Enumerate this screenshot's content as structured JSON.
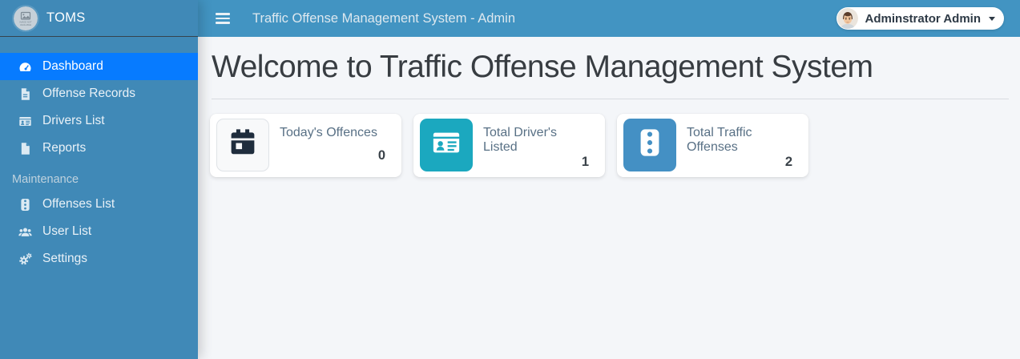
{
  "brand": {
    "name": "TOMS",
    "logo_placeholder_line1": "IMAGE NOT",
    "logo_placeholder_line2": "AVAILABLE"
  },
  "topbar": {
    "title": "Traffic Offense Management System - Admin",
    "user_name": "Adminstrator Admin"
  },
  "sidebar": {
    "nav_items": [
      {
        "label": "Dashboard",
        "icon": "tachometer-icon",
        "active": true
      },
      {
        "label": "Offense Records",
        "icon": "file-lines-icon",
        "active": false
      },
      {
        "label": "Drivers List",
        "icon": "id-card-icon",
        "active": false
      },
      {
        "label": "Reports",
        "icon": "file-icon",
        "active": false
      }
    ],
    "section_label": "Maintenance",
    "section_items": [
      {
        "label": "Offenses List",
        "icon": "traffic-light-icon",
        "active": false
      },
      {
        "label": "User List",
        "icon": "users-icon",
        "active": false
      },
      {
        "label": "Settings",
        "icon": "cogs-icon",
        "active": false
      }
    ]
  },
  "content": {
    "heading": "Welcome to Traffic Offense Management System",
    "stat_cards": [
      {
        "label": "Today's Offences",
        "value": "0",
        "icon": "calendar-icon",
        "icon_bg": "#f8f9fa",
        "icon_color": "#1f2d3d",
        "icon_border": "#dfe3e7"
      },
      {
        "label": "Total Driver's Listed",
        "value": "1",
        "icon": "id-card-icon",
        "icon_bg": "#1ba8bf",
        "icon_color": "#ffffff",
        "icon_border": "transparent"
      },
      {
        "label": "Total Traffic Offenses",
        "value": "2",
        "icon": "traffic-light-icon",
        "icon_bg": "#4490c4",
        "icon_color": "#ffffff",
        "icon_border": "transparent"
      }
    ]
  },
  "colors": {
    "sidebar_bg": "#4089b7",
    "topbar_bg": "#4294c2",
    "active_item_bg": "#077bff",
    "content_bg": "#f4f6f9",
    "accent_teal": "#1ba8bf",
    "accent_blue": "#4490c4"
  }
}
